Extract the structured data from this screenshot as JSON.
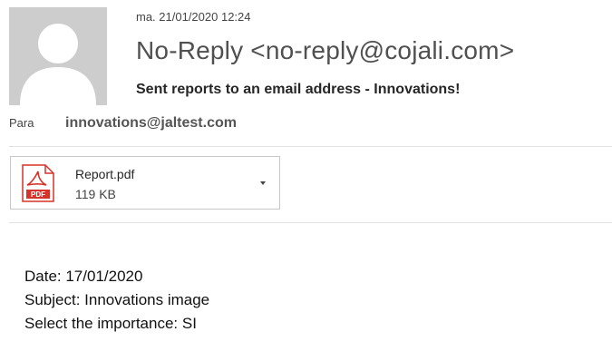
{
  "message": {
    "timestamp": "ma. 21/01/2020 12:24",
    "sender": "No-Reply <no-reply@cojali.com>",
    "subject": "Sent reports to an email address - Innovations!",
    "to_label": "Para",
    "to_address": "innovations@jaltest.com"
  },
  "attachment": {
    "icon": "pdf-icon",
    "icon_text": "PDF",
    "name": "Report.pdf",
    "size": "119 KB"
  },
  "body": {
    "lines": [
      "Date: 17/01/2020",
      "Subject: Innovations image",
      "Select the importance: SI"
    ]
  },
  "colors": {
    "pdf_accent": "#d7322a",
    "avatar_bg": "#cdcdcd"
  }
}
